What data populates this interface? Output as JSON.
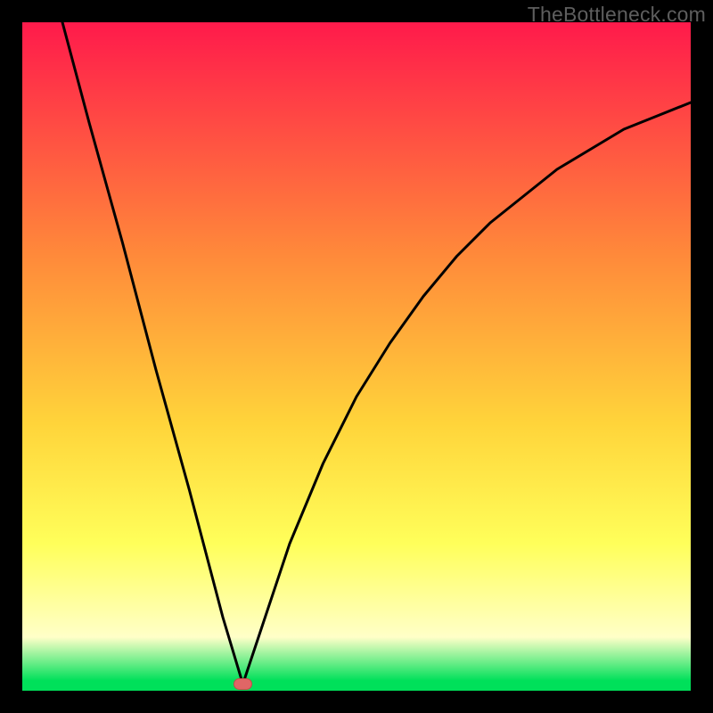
{
  "watermark": "TheBottleneck.com",
  "colors": {
    "frame": "#000000",
    "grad_top": "#ff1a4b",
    "grad_mid_upper": "#ff8a3a",
    "grad_mid": "#ffd43a",
    "grad_mid_lower": "#ffff5a",
    "grad_pale": "#ffffc8",
    "grad_green": "#00e05a",
    "curve": "#000000",
    "marker_fill": "#e06666",
    "marker_stroke": "#c74a4a"
  },
  "chart_data": {
    "type": "line",
    "title": "",
    "xlabel": "",
    "ylabel": "",
    "xlim": [
      0,
      100
    ],
    "ylim": [
      0,
      100
    ],
    "grid": false,
    "legend": false,
    "series": [
      {
        "name": "bottleneck_curve",
        "description": "V-shaped curve: steep linear descent on left, sqrt-like ascent on right, minimum near x≈33",
        "x": [
          6,
          10,
          15,
          20,
          25,
          30,
          33,
          36,
          40,
          45,
          50,
          55,
          60,
          65,
          70,
          75,
          80,
          85,
          90,
          95,
          100
        ],
        "y": [
          100,
          85,
          67,
          48,
          30,
          11,
          1,
          10,
          22,
          34,
          44,
          52,
          59,
          65,
          70,
          74,
          78,
          81,
          84,
          86,
          88
        ]
      }
    ],
    "annotations": [
      {
        "name": "min_marker",
        "x": 33,
        "y": 1,
        "shape": "rounded_rect",
        "color": "#e06666"
      }
    ],
    "background_gradient": {
      "direction": "top_to_bottom",
      "stops": [
        {
          "pos": 0.0,
          "color": "#ff1a4b"
        },
        {
          "pos": 0.35,
          "color": "#ff8a3a"
        },
        {
          "pos": 0.6,
          "color": "#ffd43a"
        },
        {
          "pos": 0.78,
          "color": "#ffff5a"
        },
        {
          "pos": 0.92,
          "color": "#ffffc8"
        },
        {
          "pos": 0.985,
          "color": "#00e05a"
        }
      ]
    }
  }
}
